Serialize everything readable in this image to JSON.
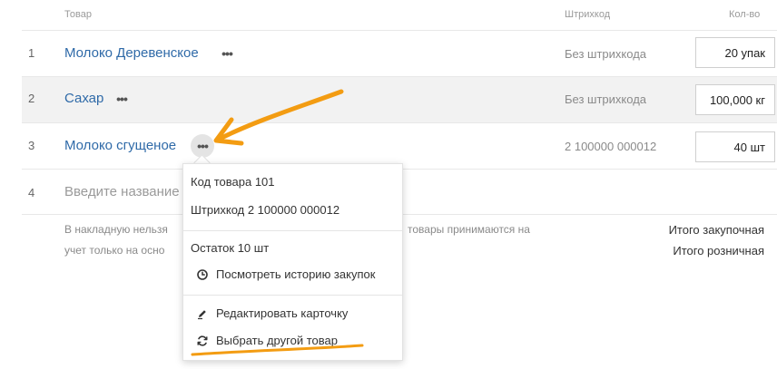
{
  "header": {
    "product_col": "Товар",
    "barcode_col": "Штрихкод",
    "qty_col": "Кол-во"
  },
  "rows": [
    {
      "num": "1",
      "name": "Молоко Деревенское",
      "barcode": "Без штрихкода",
      "qty": "20 упак"
    },
    {
      "num": "2",
      "name": "Сахар",
      "barcode": "Без штрихкода",
      "qty": "100,000 кг"
    },
    {
      "num": "3",
      "name": "Молоко сгущеное",
      "barcode": "2 100000 000012",
      "qty": "40 шт"
    }
  ],
  "new_row": {
    "num": "4",
    "placeholder": "Введите название"
  },
  "more_glyph": "•••",
  "note": {
    "line1_left": "В накладную нельзя",
    "line1_right": "товары принимаются на",
    "line2": "учет только на осно"
  },
  "totals": {
    "purchase_label": "Итого закупочная",
    "retail_label": "Итого розничная"
  },
  "popup": {
    "code": "Код товара 101",
    "barcode": "Штрихкод 2 100000 000012",
    "stock": "Остаток 10 шт",
    "history_action": "Посмотреть историю закупок",
    "edit_action": "Редактировать карточку",
    "replace_action": "Выбрать другой товар"
  },
  "colors": {
    "link": "#2f6aa8",
    "annotation": "#f39c12"
  }
}
